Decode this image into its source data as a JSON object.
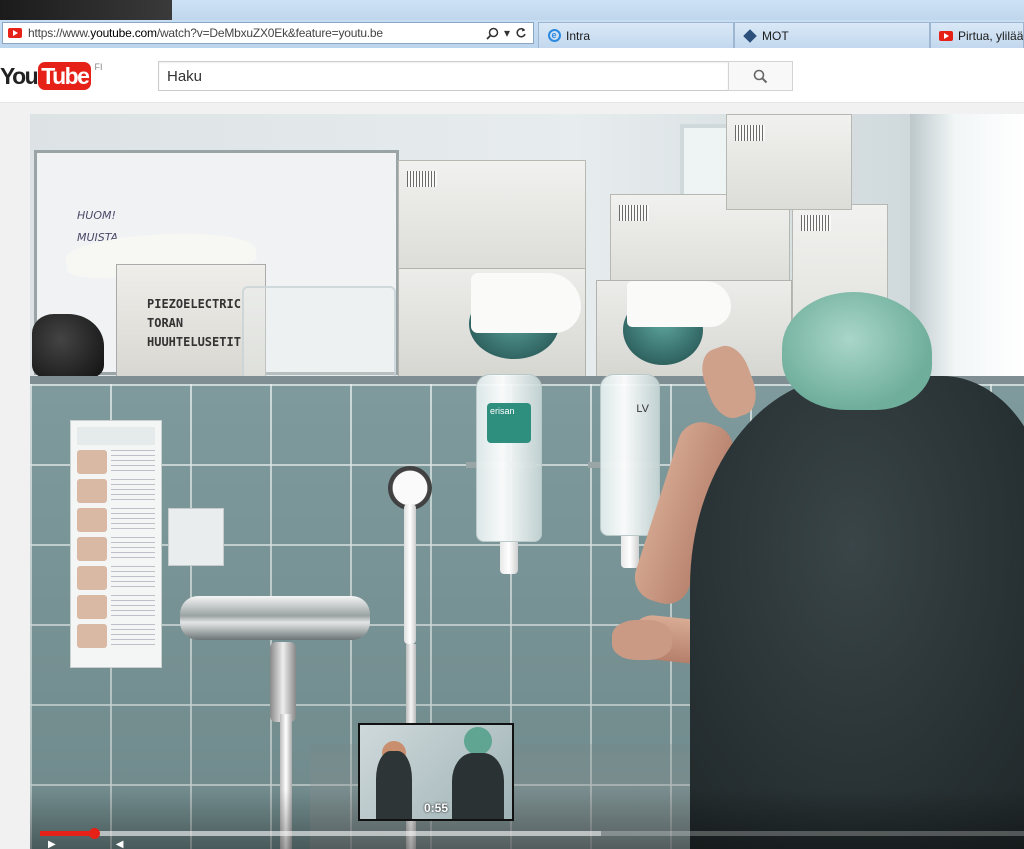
{
  "browser": {
    "url_prefix": "https://www.",
    "url_domain": "youtube.com",
    "url_rest": "/watch?v=DeMbxuZX0Ek&feature=youtu.be",
    "tabs": [
      {
        "label": "Intra",
        "icon": "ie-icon"
      },
      {
        "label": "MOT",
        "icon": "mot-icon"
      },
      {
        "label": "Pirtua, ylilääk",
        "icon": "youtube-icon"
      }
    ]
  },
  "youtube": {
    "logo_you": "You",
    "logo_tube": "Tube",
    "logo_country": "FI",
    "search_placeholder": "Haku",
    "brand_color": "#e62117"
  },
  "video": {
    "scene_text": {
      "board_note_1": "HUOM!",
      "board_note_2": "MUISTA",
      "box_label_1": "PIEZOELECTRIC",
      "box_label_2": "TORAN",
      "box_label_3": "HUUHTELUSETIT",
      "bottle_label_1": "erisan",
      "bottle_label_2": "LV"
    },
    "player": {
      "progress_fraction": 0.055,
      "buffered_fraction": 0.57,
      "preview_time": "0:55"
    }
  }
}
